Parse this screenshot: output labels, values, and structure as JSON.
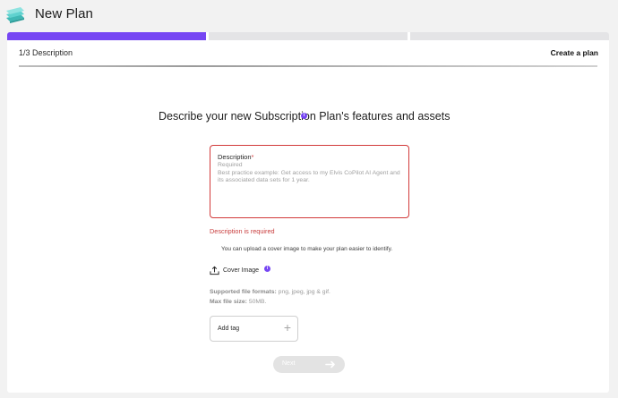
{
  "header": {
    "title": "New Plan",
    "logo_icon": "stacked-cards-logo",
    "logo_color": "#4fc7c3"
  },
  "wizard": {
    "steps_total": 3,
    "current_step": 1,
    "step_label": "1/3 Description",
    "step_title": "Create a plan",
    "accent_color": "#7646f3"
  },
  "form": {
    "heading": "Describe your new Subscription Plan's features and assets",
    "description": {
      "label": "Description",
      "required_mark": "*",
      "placeholder_line1": "Required",
      "placeholder_line2": "Best practice example: Get access to my Elvis CoPilot AI Agent and its associated data sets for 1 year.",
      "value": "",
      "error": "Description is required",
      "error_color": "#d23a3a"
    },
    "upload_hint": "You can upload a cover image to make your plan easier to identify.",
    "cover_image_label": "Cover Image",
    "formats_label": "Supported file formats:",
    "formats_value": "png, jpeg, jpg & gif.",
    "max_size_label": "Max file size:",
    "max_size_value": "50MB.",
    "tag": {
      "label": "Add tag",
      "plus": "+"
    },
    "next_label": "Next"
  }
}
